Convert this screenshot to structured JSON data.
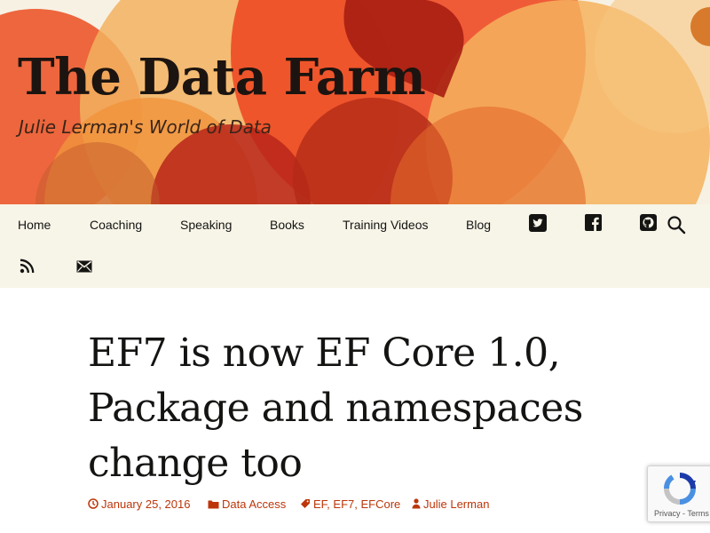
{
  "site": {
    "title": "The Data Farm",
    "tagline": "Julie Lerman's World of Data"
  },
  "nav": {
    "items": [
      {
        "label": "Home"
      },
      {
        "label": "Coaching"
      },
      {
        "label": "Speaking"
      },
      {
        "label": "Books"
      },
      {
        "label": "Training Videos"
      },
      {
        "label": "Blog"
      }
    ],
    "icons": [
      "twitter-icon",
      "facebook-icon",
      "github-icon",
      "search-icon",
      "rss-icon",
      "email-icon"
    ]
  },
  "post": {
    "title": "EF7 is now EF Core 1.0, Package and namespaces change too",
    "date": "January 25, 2016",
    "category": "Data Access",
    "tags": [
      "EF",
      "EF7",
      "EFCore"
    ],
    "author": "Julie Lerman"
  },
  "recaptcha": {
    "privacy": "Privacy",
    "separator": " - ",
    "terms": "Terms"
  },
  "colors": {
    "accent": "#bc360a",
    "nav_background": "#f7f4e8",
    "title_text": "#1c1410"
  }
}
